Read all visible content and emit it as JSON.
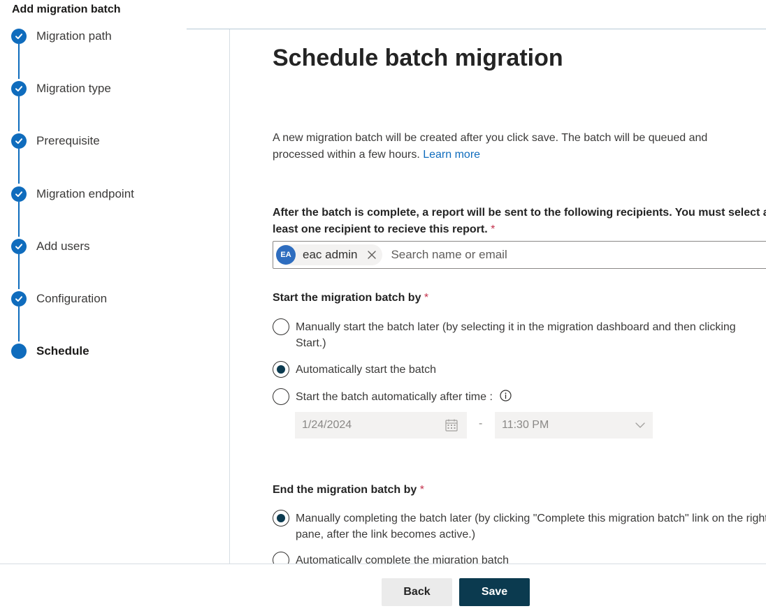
{
  "panel": {
    "title": "Add migration batch"
  },
  "steps": [
    {
      "label": "Migration path",
      "state": "done"
    },
    {
      "label": "Migration type",
      "state": "done"
    },
    {
      "label": "Prerequisite",
      "state": "done"
    },
    {
      "label": "Migration endpoint",
      "state": "done"
    },
    {
      "label": "Add users",
      "state": "done"
    },
    {
      "label": "Configuration",
      "state": "done"
    },
    {
      "label": "Schedule",
      "state": "current"
    }
  ],
  "main": {
    "title": "Schedule batch migration",
    "intro": "A new migration batch will be created after you click save. The batch will be queued and processed within a few hours.",
    "learn_more": "Learn more",
    "recipients": {
      "label": "After the batch is complete, a report will be sent to the following recipients. You must select at least one recipient to recieve this report.",
      "required_mark": "*",
      "chip": {
        "initials": "EA",
        "name": "eac admin"
      },
      "placeholder": "Search name or email"
    },
    "start": {
      "label": "Start the migration batch by",
      "required_mark": "*",
      "options": [
        {
          "label": "Manually start the batch later (by selecting it in the migration dashboard and then clicking Start.)",
          "checked": false
        },
        {
          "label": "Automatically start the batch",
          "checked": true
        },
        {
          "label": "Start the batch automatically after time :",
          "checked": false
        }
      ],
      "date": "1/24/2024",
      "separator": "-",
      "time": "11:30 PM"
    },
    "end": {
      "label": "End the migration batch by",
      "required_mark": "*",
      "options": [
        {
          "label": "Manually completing the batch later (by clicking \"Complete this migration batch\" link on the right pane, after the link becomes active.)",
          "checked": true
        },
        {
          "label": "Automatically complete the migration batch",
          "checked": false
        }
      ]
    }
  },
  "footer": {
    "back": "Back",
    "save": "Save"
  },
  "colors": {
    "accent": "#0f6cbd",
    "primary_button": "#0b3a4f",
    "required": "#c4314b"
  }
}
